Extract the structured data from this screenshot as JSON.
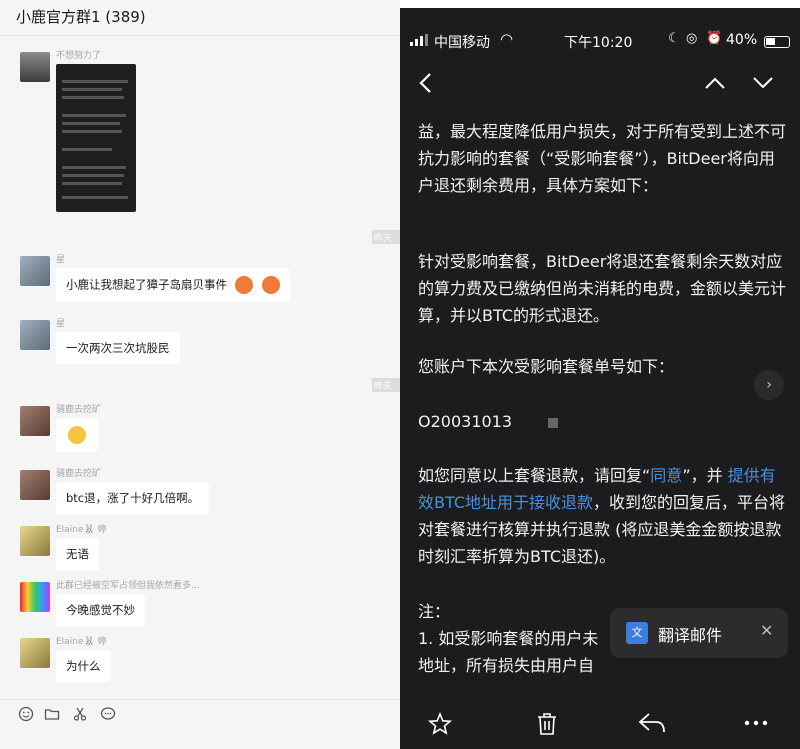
{
  "chat": {
    "title": "小鹿官方群1 (389)",
    "timestamp_label": "昨天",
    "messages": [
      {
        "sender": "不想努力了",
        "text": ""
      },
      {
        "sender": "星",
        "text": "小鹿让我想起了獐子岛扇贝事件"
      },
      {
        "sender": "星",
        "text": "一次两次三次坑股民"
      },
      {
        "sender": "骑鹿去挖矿",
        "text": ""
      },
      {
        "sender": "骑鹿去挖矿",
        "text": "btc退，涨了十好几倍啊。"
      },
      {
        "sender": "Elaine🐰 婷",
        "text": "无语"
      },
      {
        "sender": "此群已经被空军占领但我依然看多...",
        "text": "今晚感觉不妙"
      },
      {
        "sender": "Elaine🐰 婷",
        "text": "为什么"
      }
    ]
  },
  "phone": {
    "carrier": "中国移动",
    "time": "下午10:20",
    "battery": "40%",
    "paragraphs": [
      "益，最大程度降低用户损失，对于所有受到上述不可抗力影响的套餐（“受影响套餐”），BitDeer将向用户退还剩余费用，具体方案如下：",
      "针对受影响套餐，BitDeer将退还套餐剩余天数对应的算力费及已缴纳但尚未消耗的电费，金额以美元计算，并以BTC的形式退还。",
      "您账户下本次受影响套餐单号如下：",
      "O20031013"
    ],
    "agree_prefix": "如您同意以上套餐退款，请回复“",
    "agree_link": "同意",
    "agree_mid": "”，并 ",
    "agree_link2": "提供有效BTC地址用于接收退款",
    "agree_suffix": "，收到您的回复后，平台将对套餐进行核算并执行退款 (将应退美金金额按退款时刻汇率折算为BTC退还)。",
    "note_title": "注：",
    "note_1": "1. 如受影响套餐的用户未",
    "note_2": "地址，所有损失由用户自",
    "translate_label": "翻译邮件"
  }
}
